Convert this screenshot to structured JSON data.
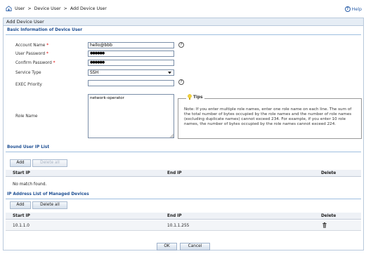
{
  "breadcrumb": {
    "items": [
      "User",
      "Device User",
      "Add Device User"
    ],
    "sep": ">"
  },
  "help": {
    "label": "Help"
  },
  "panel": {
    "title": "Add Device User"
  },
  "basic": {
    "section_title": "Basic Information of Device User",
    "account_label": "Account Name",
    "account_value": "hello@bbb",
    "password_label": "User Password",
    "password_value": "●●●●●●",
    "confirm_label": "Confirm Password",
    "confirm_value": "●●●●●●",
    "service_label": "Service Type",
    "service_value": "SSH",
    "exec_label": "EXEC Priority",
    "exec_value": "",
    "role_label": "Role Name",
    "role_value": "network-operator",
    "required_mark": "*",
    "info_glyph": "?"
  },
  "tips": {
    "title": "Tips",
    "text": "Note: If you enter multiple role names, enter one role name on each line. The sum of the total number of bytes occupied by the role names and the number of role names (excluding duplicate names) cannot exceed 234. For example, if you enter 10 role names, the number of bytes occupied by the role names cannot exceed 224."
  },
  "bound_ip": {
    "section_title": "Bound User IP List",
    "add_label": "Add",
    "delete_all_label": "Delete all",
    "col_start": "Start IP",
    "col_end": "End IP",
    "col_delete": "Delete",
    "empty_text": "No match found."
  },
  "managed": {
    "section_title": "IP Address List of Managed Devices",
    "add_label": "Add",
    "delete_all_label": "Delete all",
    "col_start": "Start IP",
    "col_end": "End IP",
    "col_delete": "Delete",
    "rows": [
      {
        "start": "10.1.1.0",
        "end": "10.1.1.255"
      }
    ]
  },
  "footer": {
    "ok_label": "OK",
    "cancel_label": "Cancel"
  },
  "icons": {
    "home": "home-icon",
    "help": "help-icon",
    "info": "info-icon",
    "dropdown": "chevron-down-icon",
    "tips": "lightbulb-icon",
    "delete": "trash-icon",
    "resize": "resize-grip-icon"
  },
  "colors": {
    "accent": "#1e4f93",
    "panel_bg": "#e6edf5",
    "required": "#dd0000"
  }
}
